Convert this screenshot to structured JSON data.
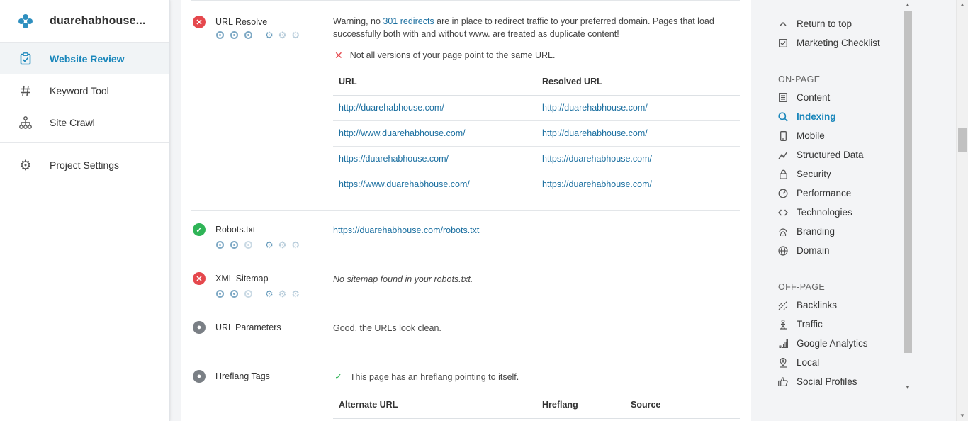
{
  "sidebar": {
    "brand": "duarehabhouse...",
    "items": [
      {
        "label": "Website Review",
        "icon": "clipboard-check-icon",
        "active": true
      },
      {
        "label": "Keyword Tool",
        "icon": "hash-icon"
      },
      {
        "label": "Site Crawl",
        "icon": "sitemap-icon"
      }
    ],
    "settings": {
      "label": "Project Settings",
      "icon": "gear-icon"
    }
  },
  "checks": {
    "url_resolve": {
      "name": "URL Resolve",
      "status": "fail",
      "warning_pre": "Warning, no ",
      "warning_link": "301 redirects",
      "warning_post": " are in place to redirect traffic to your preferred domain. Pages that load successfully both with and without www. are treated as duplicate content!",
      "message": "Not all versions of your page point to the same URL.",
      "table": {
        "headers": [
          "URL",
          "Resolved URL"
        ],
        "rows": [
          [
            "http://duarehabhouse.com/",
            "http://duarehabhouse.com/"
          ],
          [
            "http://www.duarehabhouse.com/",
            "http://duarehabhouse.com/"
          ],
          [
            "https://duarehabhouse.com/",
            "https://duarehabhouse.com/"
          ],
          [
            "https://www.duarehabhouse.com/",
            "https://duarehabhouse.com/"
          ]
        ]
      }
    },
    "robots": {
      "name": "Robots.txt",
      "status": "pass",
      "value": "https://duarehabhouse.com/robots.txt"
    },
    "sitemap": {
      "name": "XML Sitemap",
      "status": "fail",
      "value": "No sitemap found in your robots.txt."
    },
    "url_params": {
      "name": "URL Parameters",
      "status": "info",
      "value": "Good, the URLs look clean."
    },
    "hreflang": {
      "name": "Hreflang Tags",
      "status": "info",
      "message": "This page has an hreflang pointing to itself.",
      "table": {
        "headers": [
          "Alternate URL",
          "Hreflang",
          "Source"
        ]
      }
    }
  },
  "right_panel": {
    "top": [
      {
        "label": "Return to top",
        "icon": "chevron-up-icon"
      },
      {
        "label": "Marketing Checklist",
        "icon": "checkbox-icon"
      }
    ],
    "on_page_heading": "ON-PAGE",
    "on_page": [
      {
        "label": "Content",
        "icon": "document-icon"
      },
      {
        "label": "Indexing",
        "icon": "search-icon",
        "active": true
      },
      {
        "label": "Mobile",
        "icon": "mobile-icon"
      },
      {
        "label": "Structured Data",
        "icon": "structured-data-icon"
      },
      {
        "label": "Security",
        "icon": "lock-icon"
      },
      {
        "label": "Performance",
        "icon": "gauge-icon"
      },
      {
        "label": "Technologies",
        "icon": "code-icon"
      },
      {
        "label": "Branding",
        "icon": "fingerprint-icon"
      },
      {
        "label": "Domain",
        "icon": "globe-icon"
      }
    ],
    "off_page_heading": "OFF-PAGE",
    "off_page": [
      {
        "label": "Backlinks",
        "icon": "backlinks-icon"
      },
      {
        "label": "Traffic",
        "icon": "traffic-icon"
      },
      {
        "label": "Google Analytics",
        "icon": "bar-chart-icon"
      },
      {
        "label": "Local",
        "icon": "map-pin-icon"
      },
      {
        "label": "Social Profiles",
        "icon": "thumbs-up-icon"
      }
    ]
  },
  "colors": {
    "accent": "#1b87bb",
    "fail": "#e5484d",
    "pass": "#2fb457",
    "info": "#7a7f85"
  }
}
